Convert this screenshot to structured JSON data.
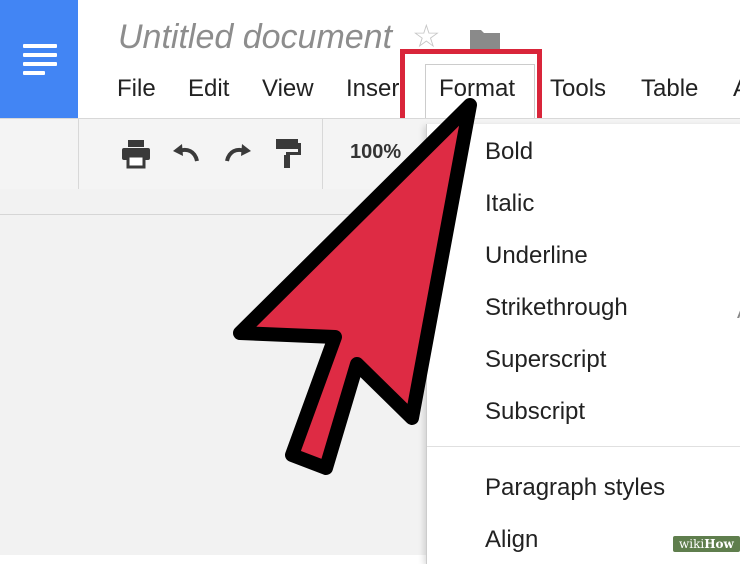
{
  "document": {
    "title": "Untitled document"
  },
  "menubar": {
    "items": [
      {
        "label": "File"
      },
      {
        "label": "Edit"
      },
      {
        "label": "View"
      },
      {
        "label": "Inser"
      },
      {
        "label": "Format"
      },
      {
        "label": "Tools"
      },
      {
        "label": "Table"
      },
      {
        "label": "A"
      }
    ],
    "active": "Format"
  },
  "toolbar": {
    "zoom": "100%"
  },
  "format_menu": {
    "items": [
      {
        "label": "Bold"
      },
      {
        "label": "Italic"
      },
      {
        "label": "Underline"
      },
      {
        "label": "Strikethrough"
      },
      {
        "label": "Superscript"
      },
      {
        "label": "Subscript"
      },
      {
        "label": "Paragraph styles"
      },
      {
        "label": "Align"
      }
    ],
    "partial_shortcut": "A"
  },
  "colors": {
    "docs_blue": "#4285f4",
    "highlight_red": "#d9253a",
    "arrow_fill": "#de2b44",
    "arrow_stroke": "#000000"
  },
  "watermark": {
    "prefix": "wiki",
    "suffix": "How"
  }
}
